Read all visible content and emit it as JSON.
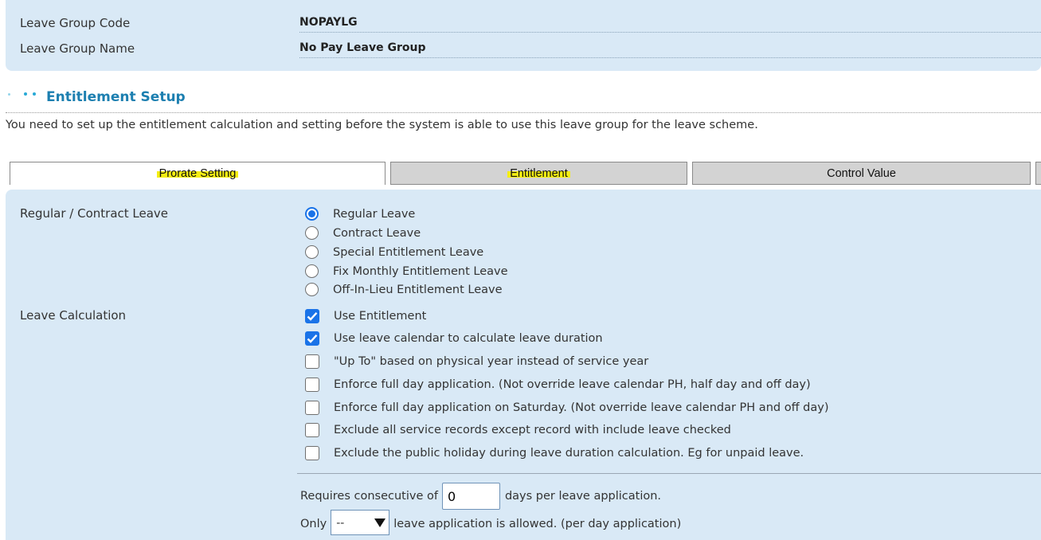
{
  "header": {
    "group_code_label": "Leave Group Code",
    "group_code_value": "NOPAYLG",
    "group_name_label": "Leave Group Name",
    "group_name_value": "No Pay Leave Group"
  },
  "section": {
    "title": "Entitlement Setup",
    "intro": "You need to set up the entitlement calculation and setting before the system is able to use this leave group for the leave scheme."
  },
  "tabs": [
    {
      "label": "Prorate Setting",
      "active": true,
      "highlighted": true
    },
    {
      "label": "Entitlement",
      "active": false,
      "highlighted": true
    },
    {
      "label": "Control Value",
      "active": false,
      "highlighted": false
    }
  ],
  "regular_contract": {
    "label": "Regular / Contract Leave",
    "options": [
      {
        "label": "Regular Leave",
        "selected": true
      },
      {
        "label": "Contract Leave",
        "selected": false
      },
      {
        "label": "Special Entitlement Leave",
        "selected": false
      },
      {
        "label": "Fix Monthly Entitlement Leave",
        "selected": false
      },
      {
        "label": "Off-In-Lieu Entitlement Leave",
        "selected": false
      }
    ]
  },
  "leave_calculation": {
    "label": "Leave Calculation",
    "options": [
      {
        "label": "Use Entitlement",
        "checked": true
      },
      {
        "label": "Use leave calendar to calculate leave duration",
        "checked": true
      },
      {
        "label": "\"Up To\" based on physical year instead of service year",
        "checked": false
      },
      {
        "label": "Enforce full day application. (Not override leave calendar PH, half day and off day)",
        "checked": false
      },
      {
        "label": "Enforce full day application on Saturday. (Not override leave calendar PH and off day)",
        "checked": false
      },
      {
        "label": "Exclude all service records except record with include leave checked",
        "checked": false
      },
      {
        "label": "Exclude the public holiday during leave duration calculation. Eg for unpaid leave.",
        "checked": false
      }
    ]
  },
  "consecutive": {
    "prefix": "Requires consecutive of",
    "value": "0",
    "suffix": "days per leave application."
  },
  "only": {
    "prefix": "Only",
    "selected": "--",
    "suffix": "leave application is allowed. (per day application)"
  },
  "colors": {
    "panel_bg": "#d9e9f6",
    "title_color": "#1c7fb0",
    "highlight": "#f4ee12",
    "checkbox_accent": "#1a73e8"
  }
}
